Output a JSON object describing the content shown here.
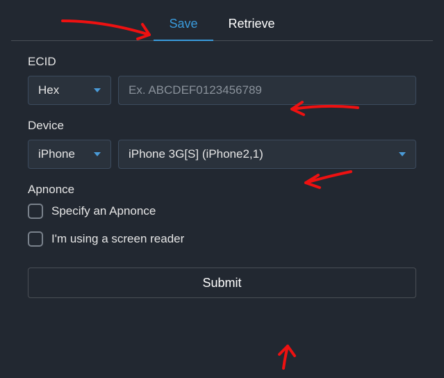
{
  "tabs": {
    "save": "Save",
    "retrieve": "Retrieve"
  },
  "ecid": {
    "label": "ECID",
    "format_selected": "Hex",
    "placeholder": "Ex. ABCDEF0123456789"
  },
  "device": {
    "label": "Device",
    "type_selected": "iPhone",
    "model_selected": "iPhone 3G[S] (iPhone2,1)"
  },
  "apnonce": {
    "label": "Apnonce",
    "specify": "Specify an Apnonce",
    "screen_reader": "I'm using a screen reader"
  },
  "submit": "Submit"
}
